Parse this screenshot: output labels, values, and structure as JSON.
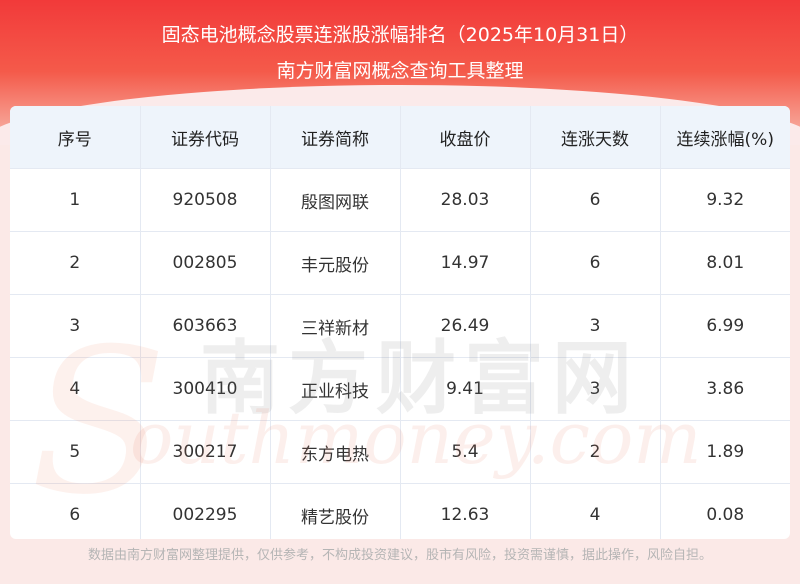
{
  "header": {
    "title_line1": "固态电池概念股票连涨股涨幅排名（2025年10月31日）",
    "title_line2": "南方财富网概念查询工具整理"
  },
  "table": {
    "columns": [
      "序号",
      "证券代码",
      "证券简称",
      "收盘价",
      "连涨天数",
      "连续涨幅(%)"
    ],
    "rows": [
      [
        "1",
        "920508",
        "殷图网联",
        "28.03",
        "6",
        "9.32"
      ],
      [
        "2",
        "002805",
        "丰元股份",
        "14.97",
        "6",
        "8.01"
      ],
      [
        "3",
        "603663",
        "三祥新材",
        "26.49",
        "3",
        "6.99"
      ],
      [
        "4",
        "300410",
        "正业科技",
        "9.41",
        "3",
        "3.86"
      ],
      [
        "5",
        "300217",
        "东方电热",
        "5.4",
        "2",
        "1.89"
      ],
      [
        "6",
        "002295",
        "精艺股份",
        "12.63",
        "4",
        "0.08"
      ]
    ]
  },
  "watermark": {
    "cn": "南方财富网",
    "en": "outhmoney.com",
    "s": "S"
  },
  "footer": {
    "disclaimer": "数据由南方财富网整理提供，仅供参考，不构成投资建议，股市有风险，投资需谨慎，据此操作，风险自担。"
  },
  "colors": {
    "header_red": "#f23a3a",
    "table_header_bg": "#eef4fb",
    "text": "#333333"
  }
}
